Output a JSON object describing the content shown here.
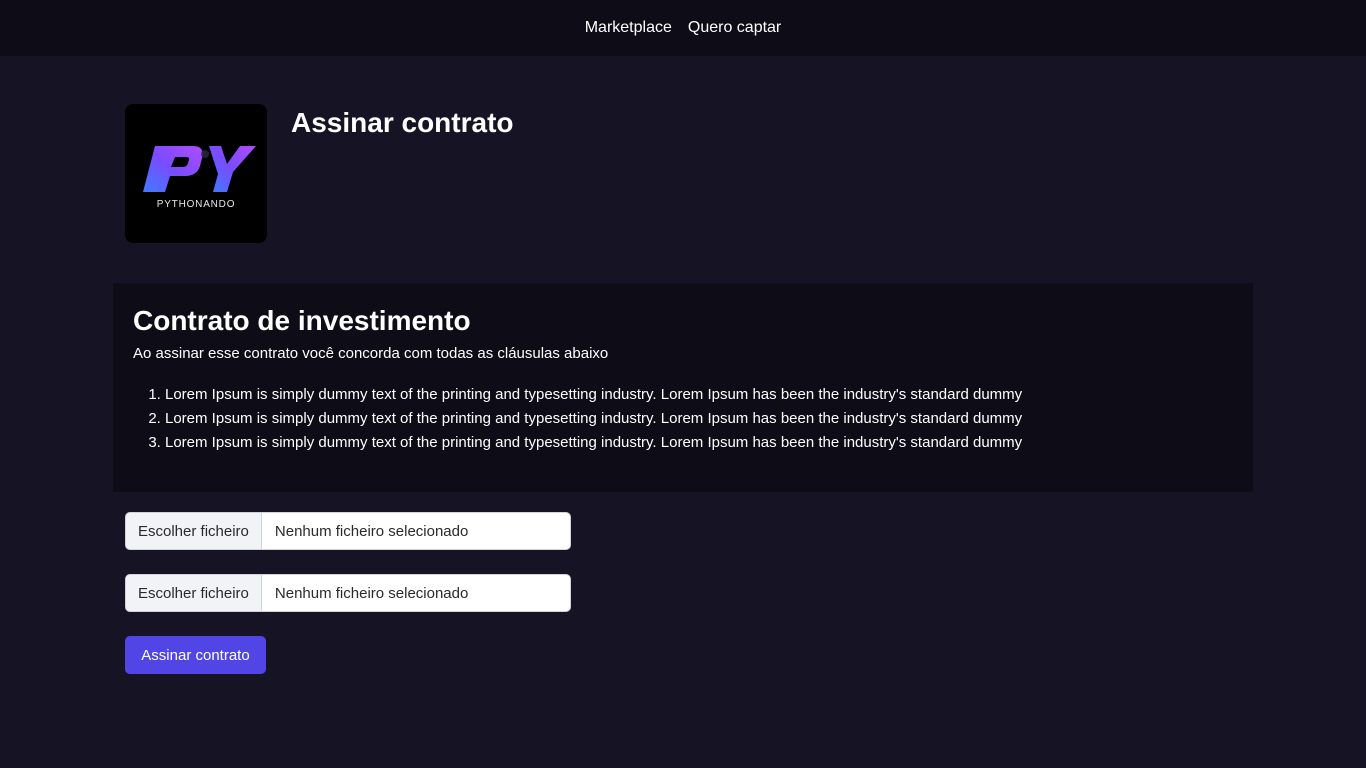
{
  "nav": {
    "items": [
      {
        "label": "Marketplace"
      },
      {
        "label": "Quero captar"
      }
    ]
  },
  "logo": {
    "mark": "PY",
    "wordmark": "PYTHONANDO"
  },
  "header": {
    "title": "Assinar contrato"
  },
  "contract": {
    "title": "Contrato de investimento",
    "intro": "Ao assinar esse contrato você concorda com todas as cláusulas abaixo",
    "clauses": [
      "Lorem Ipsum is simply dummy text of the printing and typesetting industry. Lorem Ipsum has been the industry's standard dummy",
      "Lorem Ipsum is simply dummy text of the printing and typesetting industry. Lorem Ipsum has been the industry's standard dummy",
      "Lorem Ipsum is simply dummy text of the printing and typesetting industry. Lorem Ipsum has been the industry's standard dummy"
    ]
  },
  "uploads": [
    {
      "button_label": "Escolher ficheiro",
      "status": "Nenhum ficheiro selecionado"
    },
    {
      "button_label": "Escolher ficheiro",
      "status": "Nenhum ficheiro selecionado"
    }
  ],
  "submit": {
    "label": "Assinar contrato"
  },
  "colors": {
    "page_background": "#161424",
    "nav_background": "#0e0d17",
    "card_background": "#0e0d17",
    "accent": "#5146e5"
  }
}
